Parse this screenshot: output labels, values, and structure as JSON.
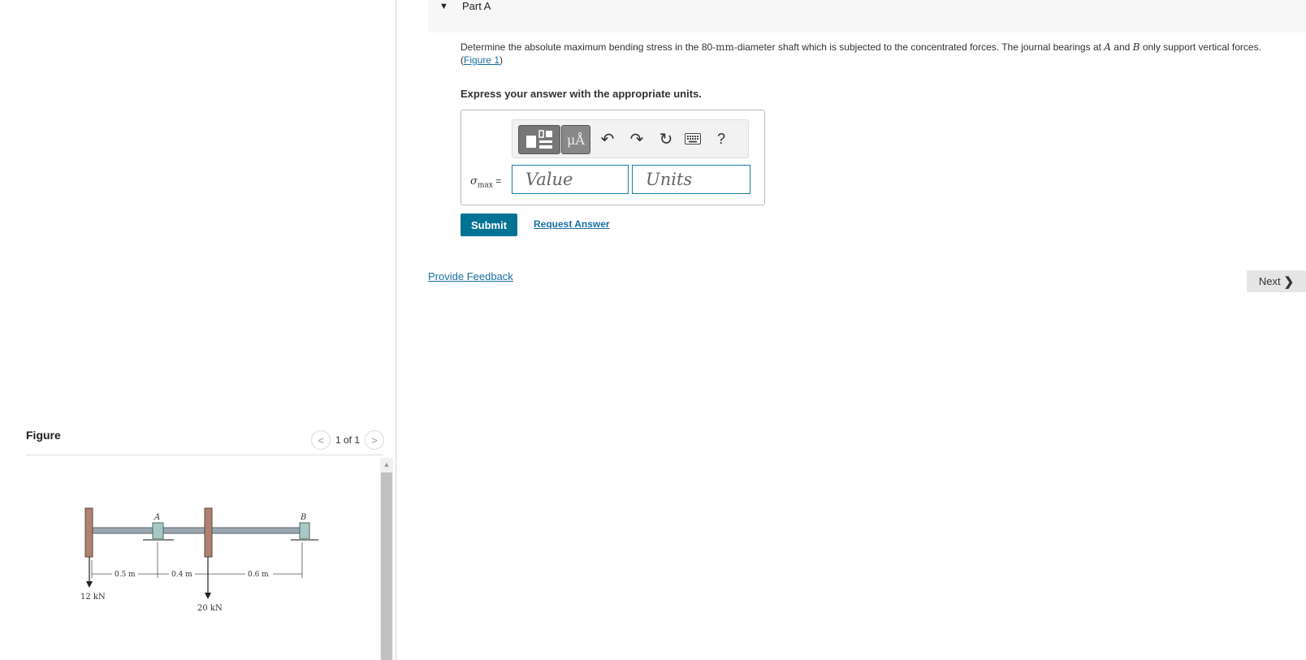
{
  "part": {
    "title": "Part A"
  },
  "question": {
    "text_1": "Determine the absolute maximum bending stress in the 80-",
    "unit_mm": "mm",
    "text_2": "-diameter shaft which is subjected to the concentrated forces. The journal bearings at ",
    "point_a": "A",
    "text_3": " and ",
    "point_b": "B",
    "text_4": " only support vertical forces.",
    "figure_link_open": "(",
    "figure_link": "Figure 1",
    "figure_link_close": ")"
  },
  "instruction": "Express your answer with the appropriate units.",
  "answer": {
    "label_symbol": "σ",
    "label_sub": "max",
    "label_eq": " =",
    "value_placeholder": "Value",
    "units_placeholder": "Units",
    "toolbar": {
      "units_symbol": "μÅ",
      "undo": "↶",
      "redo": "↷",
      "reset": "↻",
      "help": "?"
    }
  },
  "actions": {
    "submit": "Submit",
    "request_answer": "Request Answer",
    "provide_feedback": "Provide Feedback",
    "next": "Next",
    "next_chevron": "❯"
  },
  "figure_panel": {
    "title": "Figure",
    "pager": "1 of 1",
    "prev": "<",
    "next": ">",
    "labels": {
      "point_a": "A",
      "point_b": "B",
      "dim_1": "0.5 m",
      "dim_2": "0.4 m",
      "dim_3": "0.6 m",
      "load_1": "12 kN",
      "load_2": "20 kN"
    }
  },
  "colors": {
    "accent": "#007395",
    "link": "#1a6fa3",
    "input_border": "#1a7da6"
  }
}
